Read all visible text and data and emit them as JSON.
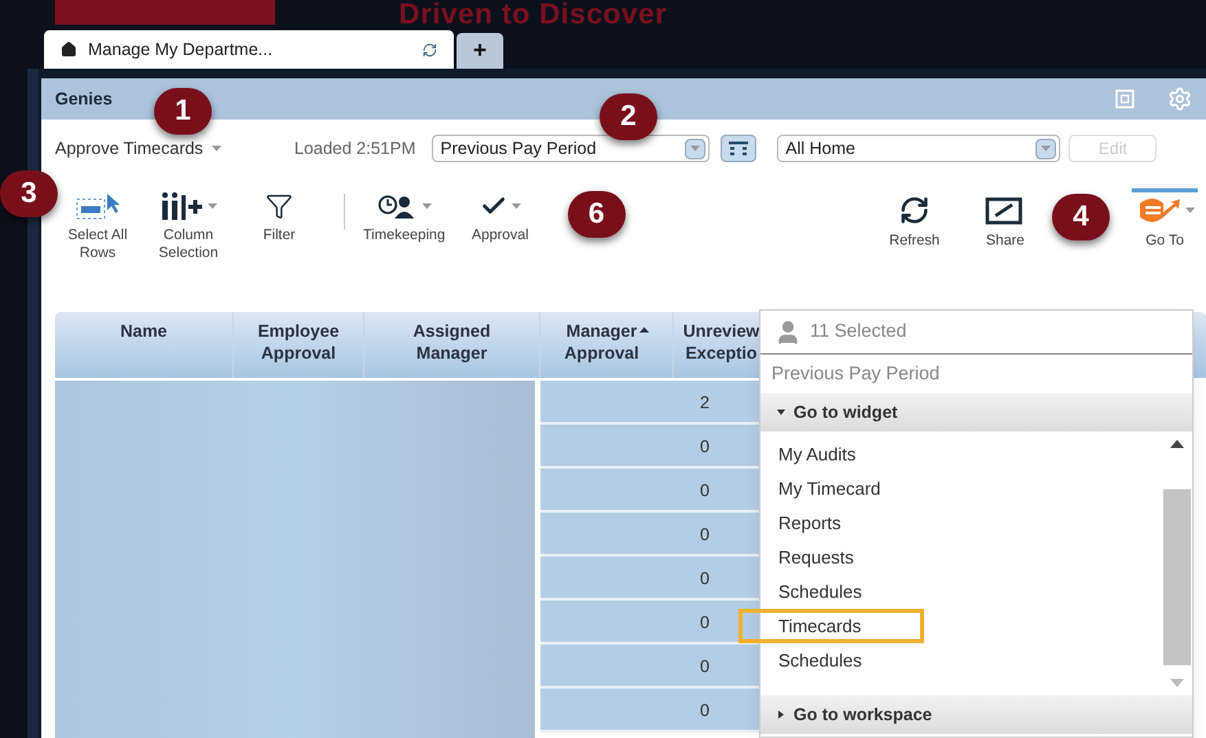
{
  "banner": {
    "text": "Driven to Discover"
  },
  "tabs": [
    {
      "label": "Manage My Departme...",
      "selected": true
    },
    {
      "label": "+",
      "selected": false
    }
  ],
  "panel": {
    "title": "Genies"
  },
  "filter_bar": {
    "view": "Approve Timecards",
    "loaded": "Loaded 2:51PM",
    "period": "Previous Pay Period",
    "location": "All Home",
    "edit": {
      "label": "Edit",
      "disabled": true
    }
  },
  "toolbar": [
    {
      "kind": "select",
      "label": "Select All\nRows",
      "caret": false
    },
    {
      "kind": "columns",
      "label": "Column\nSelection",
      "caret": true
    },
    {
      "kind": "filter",
      "label": "Filter",
      "caret": false
    },
    {
      "kind": "separator"
    },
    {
      "kind": "timekeeping",
      "label": "Timekeeping",
      "caret": true
    },
    {
      "kind": "approval",
      "label": "Approval",
      "caret": true
    }
  ],
  "toolbar_right": [
    {
      "kind": "refresh",
      "label": "Refresh",
      "selected": false
    },
    {
      "kind": "share",
      "label": "Share",
      "selected": false
    },
    {
      "kind": "goto",
      "label": "Go To",
      "selected": true
    }
  ],
  "table": {
    "columns": [
      {
        "label": "Name",
        "sorted": false
      },
      {
        "label": "Employee\nApproval",
        "sorted": false
      },
      {
        "label": "Assigned\nManager",
        "sorted": false
      },
      {
        "label": "Manager\nApproval",
        "sorted": true
      },
      {
        "label": "Unreview\nExceptio",
        "sorted": false
      }
    ],
    "rows": [
      {
        "exceptions": "2"
      },
      {
        "exceptions": "0"
      },
      {
        "exceptions": "0"
      },
      {
        "exceptions": "0"
      },
      {
        "exceptions": "0"
      },
      {
        "exceptions": "0"
      },
      {
        "exceptions": "0"
      },
      {
        "exceptions": "0"
      }
    ]
  },
  "goto_menu": {
    "selected_count": "11 Selected",
    "period": "Previous Pay Period",
    "sections": [
      {
        "label": "Go to widget",
        "expanded": true,
        "items": [
          {
            "label": "My Audits",
            "highlighted": false
          },
          {
            "label": "My Timecard",
            "highlighted": false
          },
          {
            "label": "Reports",
            "highlighted": false
          },
          {
            "label": "Requests",
            "highlighted": false
          },
          {
            "label": "Schedules",
            "highlighted": false
          },
          {
            "label": "Timecards",
            "highlighted": true
          },
          {
            "label": "Schedules",
            "highlighted": false
          }
        ]
      },
      {
        "label": "Go to workspace",
        "expanded": false
      }
    ]
  },
  "callouts": [
    {
      "number": "1"
    },
    {
      "number": "2"
    },
    {
      "number": "3"
    },
    {
      "number": "4"
    },
    {
      "number": "6"
    }
  ]
}
